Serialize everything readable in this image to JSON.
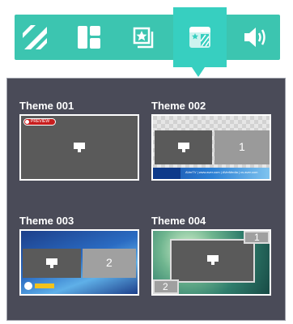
{
  "toolbar": {
    "tools": [
      {
        "icon": "diagonal-stripes-icon",
        "active": false
      },
      {
        "icon": "layout-grid-icon",
        "active": false
      },
      {
        "icon": "star-image-icon",
        "active": false
      },
      {
        "icon": "theme-template-icon",
        "active": true
      },
      {
        "icon": "speaker-icon",
        "active": false
      }
    ],
    "accent_color": "#3cc5b0",
    "active_color": "#37cfc0"
  },
  "themes": [
    {
      "title": "Theme 001",
      "badge": "PREVIEW"
    },
    {
      "title": "Theme 002",
      "pane_number": "1",
      "footer_text": "AVerTV  |  www.aver.com  |  AVerMedia  |  cs.aver.com"
    },
    {
      "title": "Theme 003",
      "pane_number": "2"
    },
    {
      "title": "Theme 004",
      "pane_number_1": "1",
      "pane_number_2": "2"
    }
  ]
}
